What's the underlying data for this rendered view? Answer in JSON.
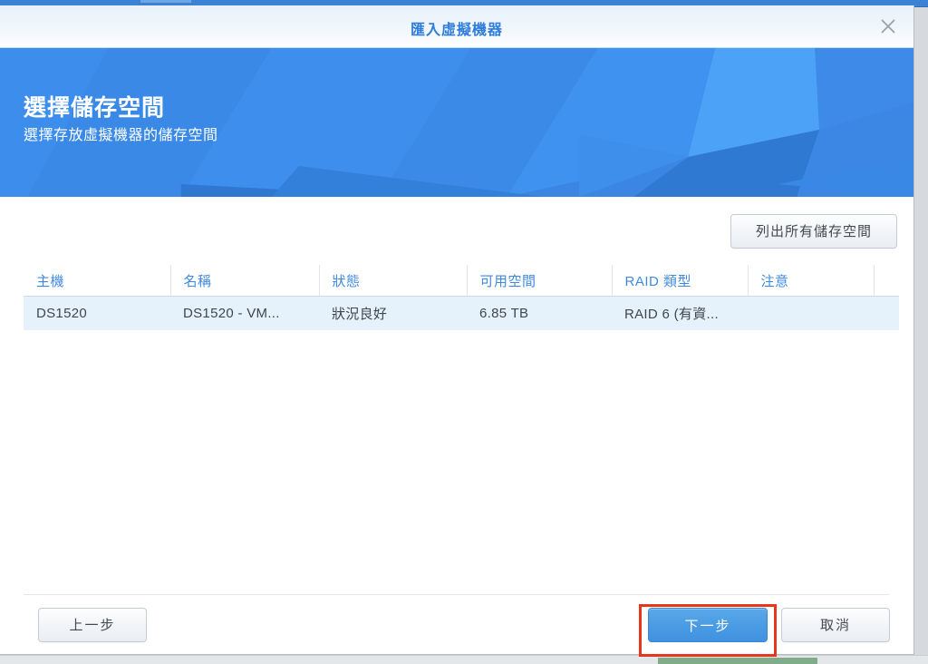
{
  "window": {
    "title": "匯入虛擬機器",
    "close_icon": "close-icon"
  },
  "banner": {
    "title": "選擇儲存空間",
    "subtitle": "選擇存放虛擬機器的儲存空間"
  },
  "toolbar": {
    "list_all_storage_label": "列出所有儲存空間"
  },
  "table": {
    "columns": [
      {
        "key": "host",
        "label": "主機"
      },
      {
        "key": "name",
        "label": "名稱"
      },
      {
        "key": "status",
        "label": "狀態"
      },
      {
        "key": "free",
        "label": "可用空間"
      },
      {
        "key": "raid",
        "label": "RAID 類型"
      },
      {
        "key": "note",
        "label": "注意"
      }
    ],
    "rows": [
      {
        "selected": true,
        "host": "DS1520",
        "name": "DS1520 - VM...",
        "status": "狀況良好",
        "free": "6.85 TB",
        "raid": "RAID 6 (有資...",
        "note": ""
      }
    ]
  },
  "footer": {
    "back_label": "上一步",
    "next_label": "下一步",
    "cancel_label": "取消"
  },
  "colors": {
    "accent_blue": "#3b8ae8",
    "title_blue": "#2f7ddb",
    "header_link_blue": "#3f8ae0",
    "status_good_green": "#5ab14a",
    "row_selected_bg": "#e6f2fb",
    "highlight_red": "#e8361c"
  }
}
